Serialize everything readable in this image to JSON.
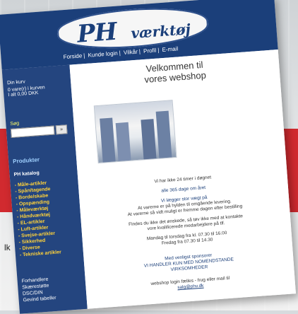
{
  "header": {
    "logo_ph": "PH",
    "logo_word": "værktøj",
    "nav": [
      "Forside",
      "Kunde login",
      "Vilkår",
      "Profil",
      "E-mail"
    ]
  },
  "sidebar": {
    "line1": "Din kurv",
    "line2": "0 vare(r) i kurven",
    "line3": "I alt 0,00 DKK",
    "search_label": "Søg",
    "search_button": "»",
    "products_title": "Produkter",
    "catalog_title": "PH katalog",
    "categories": [
      "- Måle-artikler",
      "- Spån/tagende",
      "- Borde/skabe",
      "- Opspænding",
      "- Måleværktøj",
      "- Håndværktøj",
      "- EL-artikler",
      "- Luft-artikler",
      "- Svejse-artikler",
      "- Sikkerhed",
      "- Diverse",
      "- Tekniske artikler"
    ],
    "extra": [
      "Forhandlere",
      "Skærestøtte",
      "DSC/DIN",
      "Gevind tabeller"
    ]
  },
  "main": {
    "welcome_line1": "Velkommen til",
    "welcome_line2": "vores webshop",
    "text1": "Vi har ikke 24 timer i døgnet",
    "text2": "alle 365 dage om året",
    "text3": "Vi lægger stor vægt på",
    "text4": "At varerne er på hylden til omgående levering.",
    "text5": "At varerne så vidt muligt er fremme dagen efter bestilling",
    "text6": "Findes du ikke det ønskede, så tøv ikke med at kontakte",
    "text7": "vore kvalificerede medarbejdere på tlf.",
    "text8": "Mandag til torsdag fra kl. 07.30 til 16.00",
    "text9": "Fredag fra 07.30 til 14.30",
    "text10": "Med venligst sponsorer",
    "text11": "VI HANDLER KUN MED NOMENDSTANDE",
    "text12": "VIRKSOMHEDER",
    "text13": "webshop login fælles - frug eller mail til",
    "text14": "salg@phv.dk"
  },
  "outside": {
    "fragment": "lk"
  }
}
